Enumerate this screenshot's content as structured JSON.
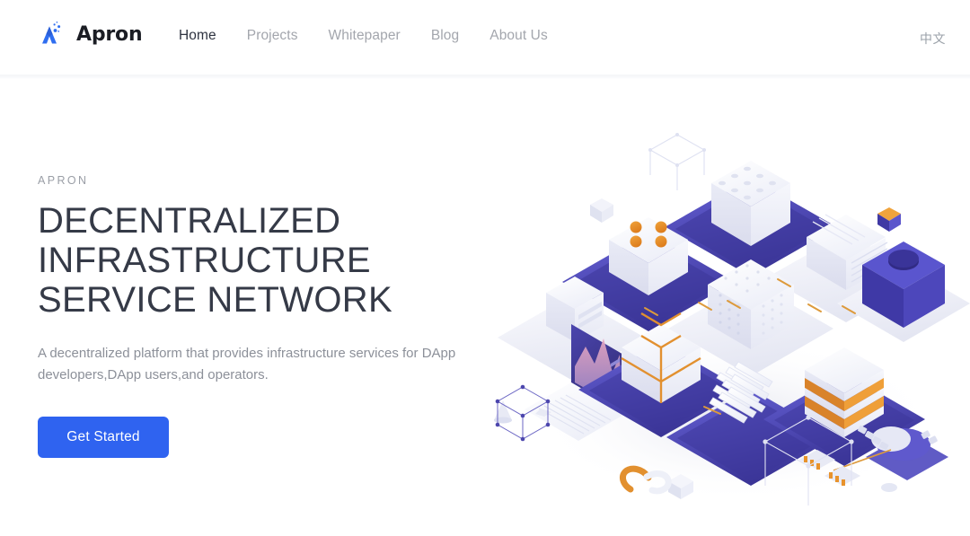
{
  "header": {
    "brand": {
      "name": "Apron",
      "logo_icon": "apron-triangle-logo-icon"
    },
    "nav": [
      {
        "label": "Home",
        "active": true
      },
      {
        "label": "Projects",
        "active": false
      },
      {
        "label": "Whitepaper",
        "active": false
      },
      {
        "label": "Blog",
        "active": false
      },
      {
        "label": "About Us",
        "active": false
      }
    ],
    "language_toggle": "中文"
  },
  "hero": {
    "eyebrow": "APRON",
    "headline_lines": [
      "DECENTRALIZED",
      "INFRASTRUCTURE",
      "SERVICE NETWORK"
    ],
    "subtitle": "A decentralized platform that provides infrastructure services for DApp developers,DApp users,and operators.",
    "cta_label": "Get Started",
    "illustration": "isometric-blockchain-infrastructure-illustration"
  },
  "colors": {
    "brand_blue": "#2f63f0",
    "logo_blue": "#2f6ef0",
    "heading_dark": "#353a47",
    "body_gray": "#8c9099",
    "nav_inactive": "#a3a6ad",
    "nav_active": "#2e3340",
    "accent_indigo": "#4a45b8",
    "accent_indigo_light": "#5c57cf",
    "accent_orange": "#e8932c",
    "tile_white": "#eef0f7",
    "page_background": "#ffffff"
  }
}
